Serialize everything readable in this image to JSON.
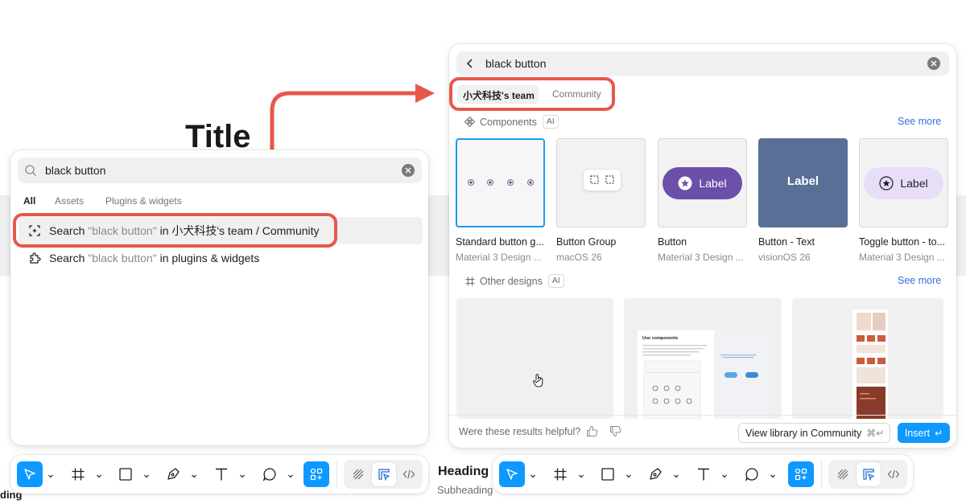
{
  "background": {
    "title": "Title",
    "heading": "Heading",
    "subheading": "Subheading",
    "heading_fragment": "ding"
  },
  "left_panel": {
    "search": {
      "value": "black button",
      "icon": "search-icon"
    },
    "tabs": [
      "All",
      "Assets",
      "Plugins & widgets"
    ],
    "results": [
      {
        "prefix": "Search",
        "query": "\"black button\"",
        "suffix": "in 小犬科技's team / Community",
        "icon": "ai-search-icon"
      },
      {
        "prefix": "Search",
        "query": "\"black button\"",
        "suffix": "in plugins & widgets",
        "icon": "plugin-icon"
      }
    ]
  },
  "right_panel": {
    "search": {
      "value": "black button"
    },
    "scope_tabs": [
      "小犬科技's team",
      "Community"
    ],
    "components": {
      "label": "Components",
      "ai_badge": "AI",
      "see_more": "See more",
      "items": [
        {
          "title": "Standard button g...",
          "subtitle": "Material 3 Design ..."
        },
        {
          "title": "Button Group",
          "subtitle": "macOS 26"
        },
        {
          "title": "Button",
          "subtitle": "Material 3 Design ...",
          "preview_label": "Label"
        },
        {
          "title": "Button - Text",
          "subtitle": "visionOS 26",
          "preview_label": "Label"
        },
        {
          "title": "Toggle button - to...",
          "subtitle": "Material 3 Design ...",
          "preview_label": "Label"
        }
      ]
    },
    "other_designs": {
      "label": "Other designs",
      "ai_badge": "AI",
      "see_more": "See more",
      "thumb_heading": "Use components"
    },
    "footer": {
      "question": "Were these results helpful?",
      "view_library": "View library in Community",
      "view_library_shortcut": "⌘↵",
      "insert": "Insert",
      "insert_shortcut": "↵"
    }
  },
  "colors": {
    "accent": "#0d99ff",
    "annotation_red": "#e8574c",
    "link": "#2f6fe3",
    "m3_purple": "#6b4fa8",
    "m3_tonal": "#e8def8",
    "vision_blue": "#5a6f96"
  }
}
